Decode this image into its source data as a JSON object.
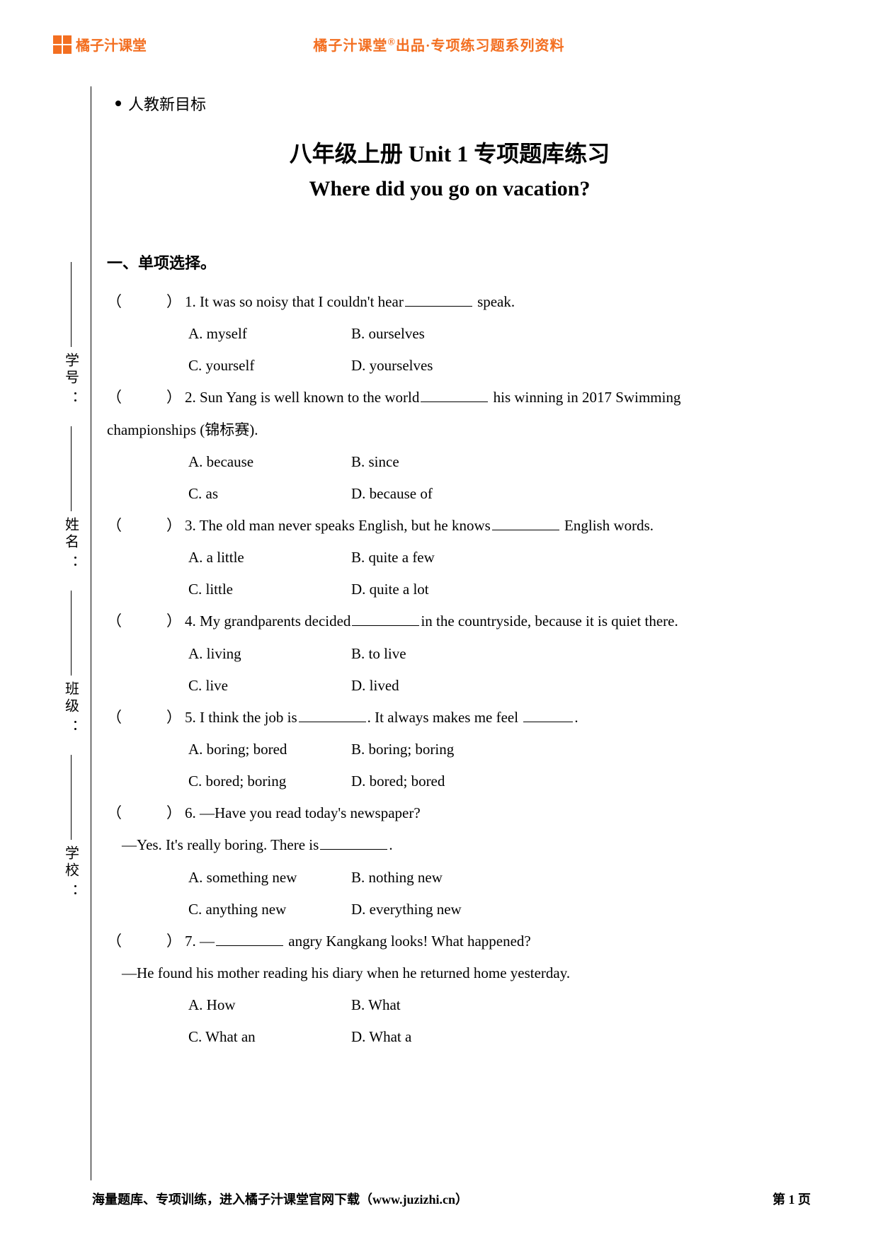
{
  "brand": "橘子汁课堂",
  "header_center": "橘子汁课堂®出品·专项练习题系列资料",
  "curriculum": "人教新目标",
  "title_cn": "八年级上册 Unit 1  专项题库练习",
  "title_en": "Where did you go on vacation?",
  "section1": "一、单项选择。",
  "side": {
    "xuehao": "学号",
    "xingming": "姓名",
    "banji": "班级",
    "xuexiao": "学校"
  },
  "q": [
    {
      "num": "1",
      "stem_before": "It was so noisy that I couldn't hear",
      "stem_after": " speak.",
      "A": "A. myself",
      "B": "B. ourselves",
      "C": "C. yourself",
      "D": "D. yourselves"
    },
    {
      "num": "2",
      "stem_before": "Sun Yang is well known to the world",
      "stem_after": " his winning in 2017    Swimming",
      "line2": "championships (锦标赛).",
      "A": "A. because",
      "B": "B. since",
      "C": "C. as",
      "D": "D. because of"
    },
    {
      "num": "3",
      "stem_before": "The old man never speaks English, but he knows",
      "stem_after": " English words.",
      "A": "A. a little",
      "B": "B. quite a few",
      "C": "C. little",
      "D": "D. quite a lot"
    },
    {
      "num": "4",
      "stem_before": "My grandparents decided",
      "stem_after": "in the countryside, because it is    quiet there.",
      "A": "A. living",
      "B": "B. to live",
      "C": "C. live",
      "D": "D. lived"
    },
    {
      "num": "5",
      "stem_before": "I think the job is",
      "stem_mid": ". It always makes me feel ",
      "stem_after": ".",
      "A": "A. boring; bored",
      "B": "B. boring; boring",
      "C": "C. bored; boring",
      "D": "D. bored; bored"
    },
    {
      "num": "6",
      "stem_before": "—Have you read today's newspaper?",
      "line2_before": "—Yes. It's really boring. There is",
      "line2_after": ".",
      "A": "A. something new",
      "B": "B. nothing new",
      "C": "C. anything new",
      "D": "D. everything new"
    },
    {
      "num": "7",
      "stem_before": "—",
      "stem_after": " angry Kangkang looks! What happened?",
      "line2": "—He found his mother reading his diary when he returned home yesterday.",
      "A": "A. How",
      "B": "B. What",
      "C": "C. What an",
      "D": "D. What a"
    }
  ],
  "footer_left": "海量题库、专项训练，进入橘子汁课堂官网下载（www.juzizhi.cn）",
  "footer_right": "第 1 页"
}
